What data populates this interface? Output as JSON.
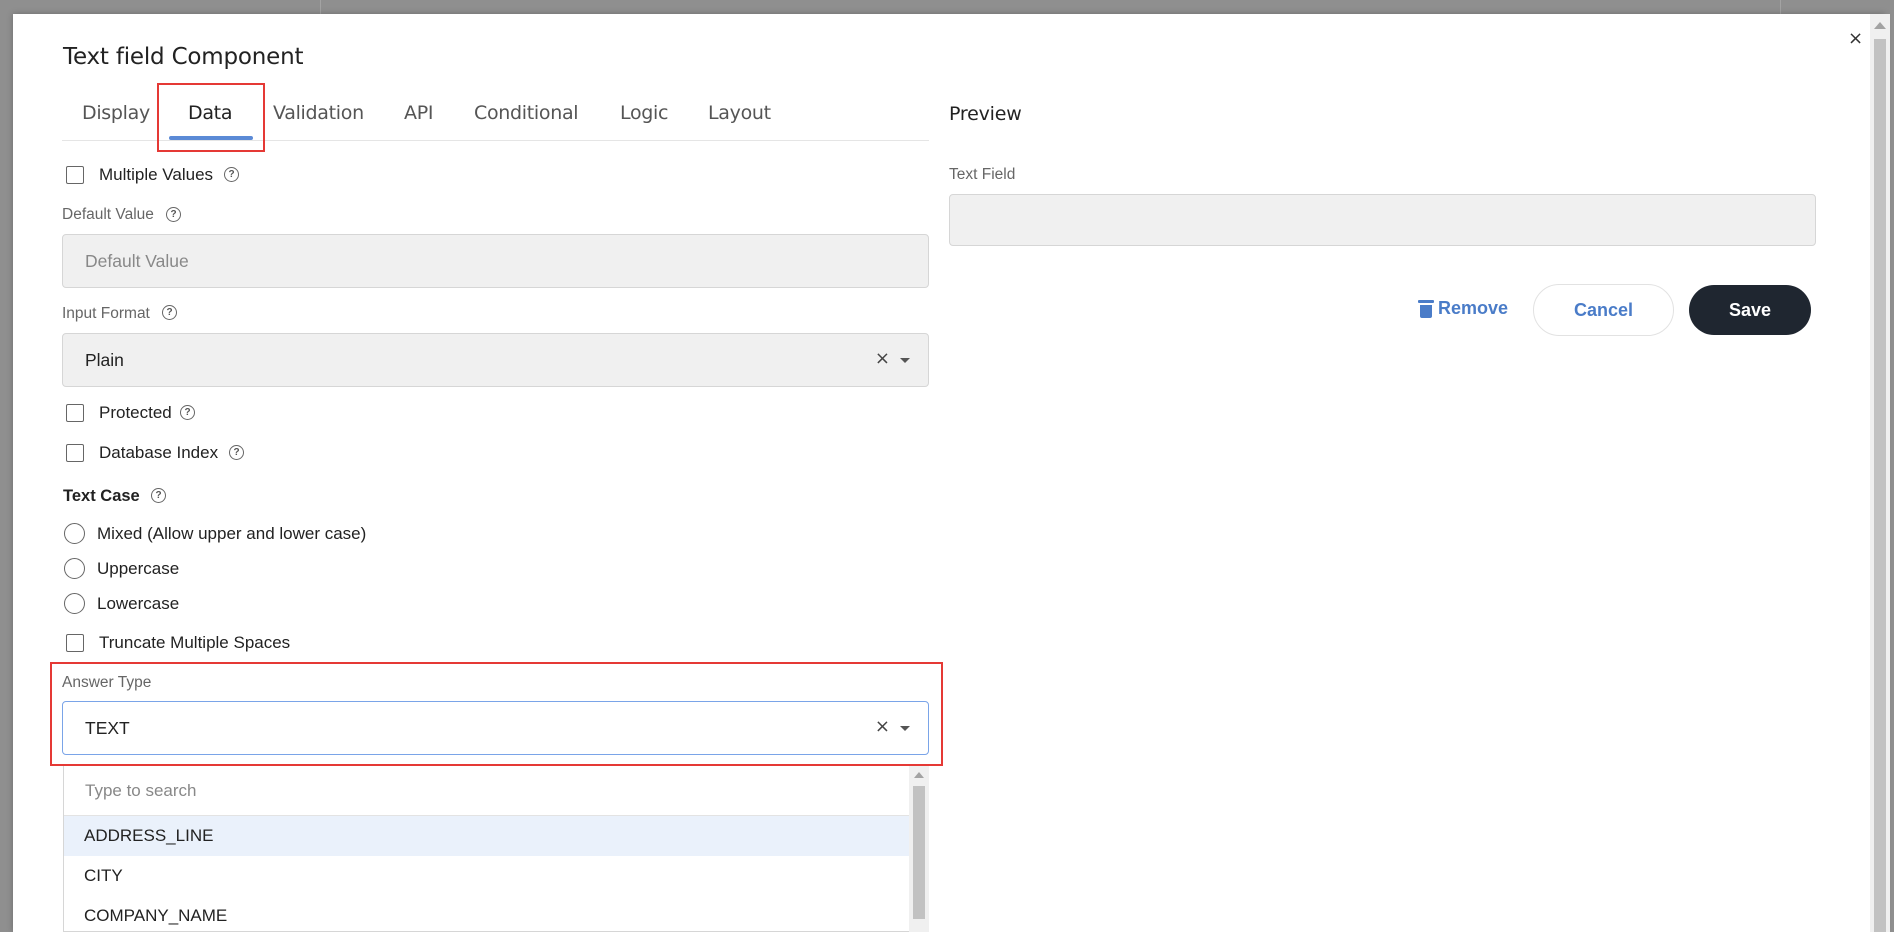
{
  "modal": {
    "title": "Text field Component",
    "close_glyph": "×"
  },
  "tabs": [
    {
      "label": "Display"
    },
    {
      "label": "Data"
    },
    {
      "label": "Validation"
    },
    {
      "label": "API"
    },
    {
      "label": "Conditional"
    },
    {
      "label": "Logic"
    },
    {
      "label": "Layout"
    }
  ],
  "active_tab": "Data",
  "form": {
    "multiple_values_label": "Multiple Values",
    "default_value_label": "Default Value",
    "default_value_placeholder": "Default Value",
    "input_format_label": "Input Format",
    "input_format_value": "Plain",
    "protected_label": "Protected",
    "database_index_label": "Database Index",
    "text_case_label": "Text Case",
    "text_case_options": [
      {
        "label": "Mixed (Allow upper and lower case)"
      },
      {
        "label": "Uppercase"
      },
      {
        "label": "Lowercase"
      }
    ],
    "truncate_label": "Truncate Multiple Spaces",
    "answer_type_label": "Answer Type",
    "answer_type_value": "TEXT",
    "clear_glyph": "×",
    "help_glyph": "?"
  },
  "dropdown": {
    "search_placeholder": "Type to search",
    "options": [
      {
        "label": "ADDRESS_LINE"
      },
      {
        "label": "CITY"
      },
      {
        "label": "COMPANY_NAME"
      }
    ],
    "highlighted_option": "ADDRESS_LINE"
  },
  "preview": {
    "title": "Preview",
    "field_label": "Text Field"
  },
  "actions": {
    "remove_label": "Remove",
    "cancel_label": "Cancel",
    "save_label": "Save"
  },
  "colors": {
    "accent": "#4a7cc8",
    "tab_underline": "#5b8ad6",
    "highlight_box": "#e53935",
    "save_bg": "#1f2630"
  },
  "icons": [
    "close-icon",
    "help-icon",
    "clear-icon",
    "chevron-down-icon",
    "trash-icon"
  ]
}
